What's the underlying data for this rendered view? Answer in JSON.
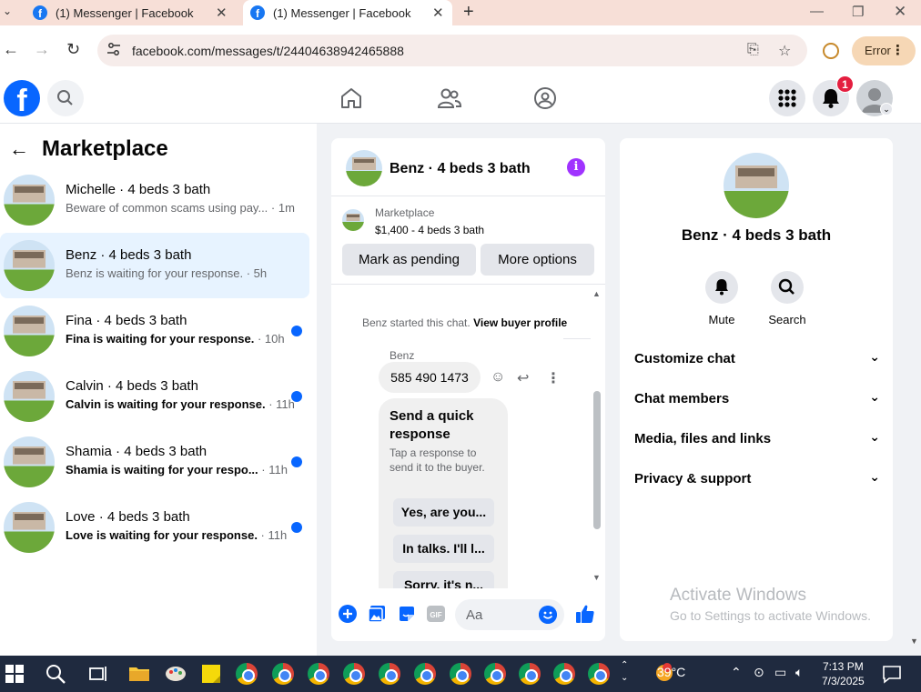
{
  "browser": {
    "tabs": [
      {
        "title": "(1) Messenger | Facebook"
      },
      {
        "title": "(1) Messenger | Facebook"
      }
    ],
    "url": "facebook.com/messages/t/24404638942465888",
    "error_label": "Error"
  },
  "fb": {
    "logo": "f",
    "notification_count": "1"
  },
  "left": {
    "title": "Marketplace",
    "conversations": [
      {
        "name": "Michelle · 4 beds 3 bath",
        "preview": "Beware of common scams using pay...",
        "time": " · 1m",
        "unread": false
      },
      {
        "name": "Benz · 4 beds 3 bath",
        "preview": "Benz is waiting for your response.",
        "time": " · 5h",
        "unread": false
      },
      {
        "name": "Fina · 4 beds 3 bath",
        "preview": "Fina is waiting for your response.",
        "time": " · 10h",
        "unread": true
      },
      {
        "name": "Calvin · 4 beds 3 bath",
        "preview": "Calvin is waiting for your response.",
        "time": " · 11h",
        "unread": true
      },
      {
        "name": "Shamia · 4 beds 3 bath",
        "preview": "Shamia is waiting for your respo...",
        "time": " · 11h",
        "unread": true
      },
      {
        "name": "Love · 4 beds 3 bath",
        "preview": "Love is waiting for your response.",
        "time": " · 11h",
        "unread": true
      }
    ]
  },
  "chat": {
    "title": "Benz · 4 beds 3 bath",
    "marketplace_label": "Marketplace",
    "listing": "$1,400 - 4 beds 3 bath",
    "mark_pending": "Mark as pending",
    "more_options": "More options",
    "started_text": "Benz started this chat.",
    "view_profile": "View buyer profile",
    "sender": "Benz",
    "message": "585 490 1473",
    "quick_title": "Send a quick response",
    "quick_desc": "Tap a response to send it to the buyer.",
    "quick_options": [
      "Yes, are you...",
      "In talks. I'll l...",
      "Sorry, it's n..."
    ],
    "input_placeholder": "Aa"
  },
  "details": {
    "title": "Benz · 4 beds 3 bath",
    "mute": "Mute",
    "search": "Search",
    "sections": [
      "Customize chat",
      "Chat members",
      "Media, files and links",
      "Privacy & support"
    ]
  },
  "watermark": {
    "line1": "Activate Windows",
    "line2": "Go to Settings to activate Windows."
  },
  "taskbar": {
    "temperature": "39°C",
    "time": "7:13 PM",
    "date": "7/3/2025"
  }
}
